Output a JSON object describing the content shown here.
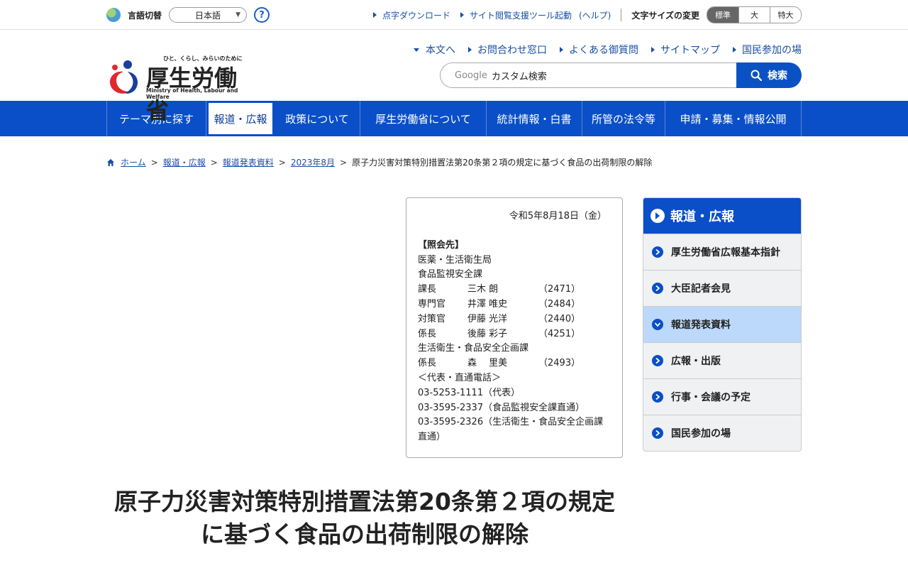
{
  "util": {
    "lang_label": "言語切替",
    "lang_value": "日本語",
    "help_symbol": "?",
    "links": [
      "点字ダウンロード",
      "サイト閲覧支援ツール起動"
    ],
    "help_link": "(ヘルプ)",
    "fontsize_label": "文字サイズの変更",
    "fontsize_options": [
      "標準",
      "大",
      "特大"
    ]
  },
  "header": {
    "logo_tag": "ひと、くらし、みらいのために",
    "logo_name": "厚生労働省",
    "logo_en": "Ministry of Health, Labour and Welfare",
    "nav": [
      "本文へ",
      "お問合わせ窓口",
      "よくある御質問",
      "サイトマップ",
      "国民参加の場"
    ],
    "search_google": "Google",
    "search_placeholder": "カスタム検索",
    "search_button": "検索"
  },
  "mainnav": [
    "テーマ別に探す",
    "報道・広報",
    "政策について",
    "厚生労働省について",
    "統計情報・白書",
    "所管の法令等",
    "申請・募集・情報公開"
  ],
  "breadcrumb": [
    "ホーム",
    "報道・広報",
    "報道発表資料",
    "2023年8月",
    "原子力災害対策特別措置法第20条第２項の規定に基づく食品の出荷制限の解除"
  ],
  "contact": {
    "date": "令和5年8月18日（金）",
    "heading": "【照会先】",
    "bureau": "医薬・生活衛生局",
    "division1": "食品監視安全課",
    "staff1": [
      {
        "role": "課長",
        "name": "三木 朗",
        "ext": "（2471）"
      },
      {
        "role": "専門官",
        "name": "井澤 唯史",
        "ext": "（2484）"
      },
      {
        "role": "対策官",
        "name": "伊藤 光洋",
        "ext": "（2440）"
      },
      {
        "role": "係長",
        "name": "後藤 彩子",
        "ext": "（4251）"
      }
    ],
    "division2": "生活衛生・食品安全企画課",
    "staff2": [
      {
        "role": "係長",
        "name": "森　 里美",
        "ext": "（2493）"
      }
    ],
    "phones_heading": "＜代表・直通電話＞",
    "phone1": "03-5253-1111（代表）",
    "phone2": "03-3595-2337（食品監視安全課直通）",
    "phone3": "03-3595-2326（生活衛生・食品安全企画課直通）"
  },
  "title": "原子力災害対策特別措置法第20条第２項の規定に基づく食品の出荷制限の解除",
  "side": {
    "heading": "報道・広報",
    "items": [
      "厚生労働省広報基本指針",
      "大臣記者会見",
      "報道発表資料",
      "広報・出版",
      "行事・会議の予定",
      "国民参加の場"
    ],
    "active_index": 2
  },
  "colors": {
    "brand_blue": "#0a4fc7",
    "link": "#1a4fa3",
    "side_active": "#bcd8fb"
  }
}
